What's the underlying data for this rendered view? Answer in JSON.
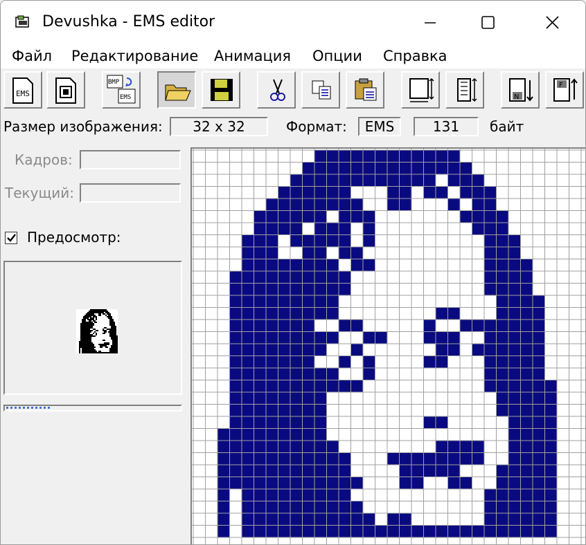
{
  "window": {
    "title": "Devushka - EMS editor"
  },
  "menu": [
    "Файл",
    "Редактирование",
    "Анимация",
    "Опции",
    "Справка"
  ],
  "toolbar": {
    "buttons": [
      {
        "name": "new-ems-button",
        "icon": "ems-file-icon"
      },
      {
        "name": "new-animation-button",
        "icon": "film-icon"
      },
      {
        "name": "convert-bmp-ems-button",
        "icon": "bmp-to-ems-icon"
      },
      {
        "name": "open-button",
        "icon": "folder-open-icon",
        "pressed": true
      },
      {
        "name": "save-button",
        "icon": "floppy-icon"
      },
      {
        "name": "cut-button",
        "icon": "scissors-icon"
      },
      {
        "name": "copy-button",
        "icon": "copy-icon"
      },
      {
        "name": "paste-button",
        "icon": "paste-icon"
      },
      {
        "name": "resize-button",
        "icon": "resize-icon"
      },
      {
        "name": "frame-size-button",
        "icon": "frame-size-icon"
      },
      {
        "name": "next-frame-button",
        "icon": "next-frame-icon"
      },
      {
        "name": "first-frame-button",
        "icon": "first-frame-icon"
      }
    ]
  },
  "info": {
    "size_label": "Размер изображения:",
    "size_value": "32 x 32",
    "format_label": "Формат:",
    "format_value": "EMS",
    "bytes_value": "131",
    "bytes_unit": "байт"
  },
  "left": {
    "frames_label": "Кадров:",
    "frames_value": "",
    "current_label": "Текущий:",
    "current_value": "",
    "preview_label": "Предосмотр:",
    "preview_checked": true
  },
  "colors": {
    "pixel": "#0a0a80",
    "grid": "#a0a0a0",
    "preview_pixel": "#000000"
  },
  "image": {
    "width": 32,
    "height": 32,
    "visible_rows": 32,
    "rows": [
      "000000000011111111111100000000",
      "000000000111111111111110000000",
      "000000001111111111110111000000",
      "000000011111100011011011100000",
      "000000111111110011000101100000",
      "000001111110111000000011110000",
      "000001111011101000000001110000",
      "000011101111101000000000111000",
      "000011100110110000000000111000",
      "000011111111011000000000111100",
      "000111111111100000000000111100",
      "000111111111100000000000111100",
      "000111111111000000000000011110",
      "000111111111000000001100011110",
      "000111111100110000010011111110",
      "000111111111001100011100111110",
      "000111111110010000001101111110",
      "000111111100101000011000111110",
      "000111111111001000000000111110",
      "000111111111110000000000111111",
      "000111111110000000000000011111",
      "000111111110000000000000011111",
      "000111111110000000011000001111",
      "001111111110000000000000001111",
      "001111111111000000001111001111",
      "001111111111100011111111001111",
      "001111111111100001111100011111",
      "001111111111110001100110011111",
      "001011111111100000000000111111",
      "001011111111110000000000111111",
      "001011111111111011000000111111",
      "001011111111111111111111111111"
    ]
  }
}
